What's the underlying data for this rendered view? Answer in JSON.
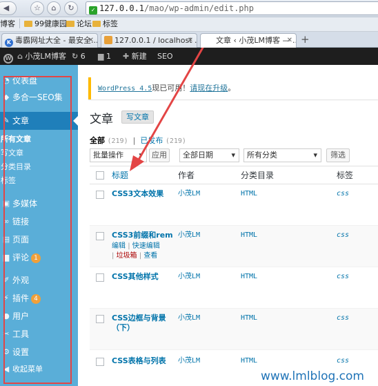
{
  "browser": {
    "url_host": "127.0.0.1",
    "url_path": "/mao/wp-admin/edit.php",
    "bookmarks": [
      "博客",
      "99健康园",
      "论坛",
      "标签"
    ],
    "tabs": [
      {
        "title": "毒霸网址大全 - 最安全...",
        "icon": "K",
        "active": false
      },
      {
        "title": "127.0.0.1 / localhost ...",
        "icon": "PMA",
        "active": false
      },
      {
        "title": "文章 ‹ 小茂LM博客 — ...",
        "icon": "",
        "active": true
      }
    ],
    "new_tab": "+"
  },
  "adminbar": {
    "site": "小茂LM博客",
    "updates": "6",
    "comments": "1",
    "new": "新建",
    "seo": "SEO"
  },
  "sidebar": {
    "items": [
      {
        "label": "仪表盘",
        "icon": "dashboard-icon"
      },
      {
        "label": "多合一SEO集",
        "icon": "seo-icon"
      },
      {
        "label": "文章",
        "icon": "pin-icon"
      },
      {
        "label": "多媒体",
        "icon": "media-icon"
      },
      {
        "label": "链接",
        "icon": "link-icon"
      },
      {
        "label": "页面",
        "icon": "page-icon"
      },
      {
        "label": "评论",
        "icon": "comment-icon",
        "badge": "1"
      },
      {
        "label": "外观",
        "icon": "brush-icon"
      },
      {
        "label": "插件",
        "icon": "plugin-icon",
        "badge": "4"
      },
      {
        "label": "用户",
        "icon": "user-icon"
      },
      {
        "label": "工具",
        "icon": "tools-icon"
      },
      {
        "label": "设置",
        "icon": "settings-icon"
      },
      {
        "label": "收起菜单",
        "icon": "collapse-icon"
      }
    ],
    "submenu": [
      "所有文章",
      "写文章",
      "分类目录",
      "标签"
    ]
  },
  "notice": {
    "version_link": "WordPress 4.5",
    "text": "现已可用！",
    "update_link": "请现在升级",
    "end": "。"
  },
  "page": {
    "title": "文章",
    "add_new": "写文章",
    "view_all": "全部",
    "view_all_count": "(219)",
    "view_sep": "|",
    "view_published": "已发布",
    "view_published_count": "(219)"
  },
  "filters": {
    "bulk": "批量操作",
    "apply": "应用",
    "dates": "全部日期",
    "cats": "所有分类",
    "filter": "筛选"
  },
  "table": {
    "headers": {
      "title": "标题",
      "author": "作者",
      "category": "分类目录",
      "tags": "标签"
    },
    "row_actions": {
      "edit": "编辑",
      "quick_edit": "快速编辑",
      "trash": "垃圾箱",
      "view": "查看",
      "sep": "|"
    },
    "rows": [
      {
        "title": "CSS3文本效果",
        "author": "小茂LM",
        "category": "HTML",
        "tags": "css"
      },
      {
        "title": "CSS3前缀和rem",
        "author": "小茂LM",
        "category": "HTML",
        "tags": "css"
      },
      {
        "title": "CSS其他样式",
        "author": "小茂LM",
        "category": "HTML",
        "tags": "css"
      },
      {
        "title": "CSS边框与背景",
        "title2": "（下）",
        "author": "小茂LM",
        "category": "HTML",
        "tags": "css"
      },
      {
        "title": "CSS表格与列表",
        "author": "小茂LM",
        "category": "HTML",
        "tags": "css"
      }
    ]
  },
  "watermark": "www.lmlblog.com",
  "colors": {
    "sidebar": "#5aaed8",
    "sidebar_current": "#1f7fba",
    "annotation": "#e34545",
    "link": "#0073aa",
    "notice_border": "#ffba00"
  }
}
